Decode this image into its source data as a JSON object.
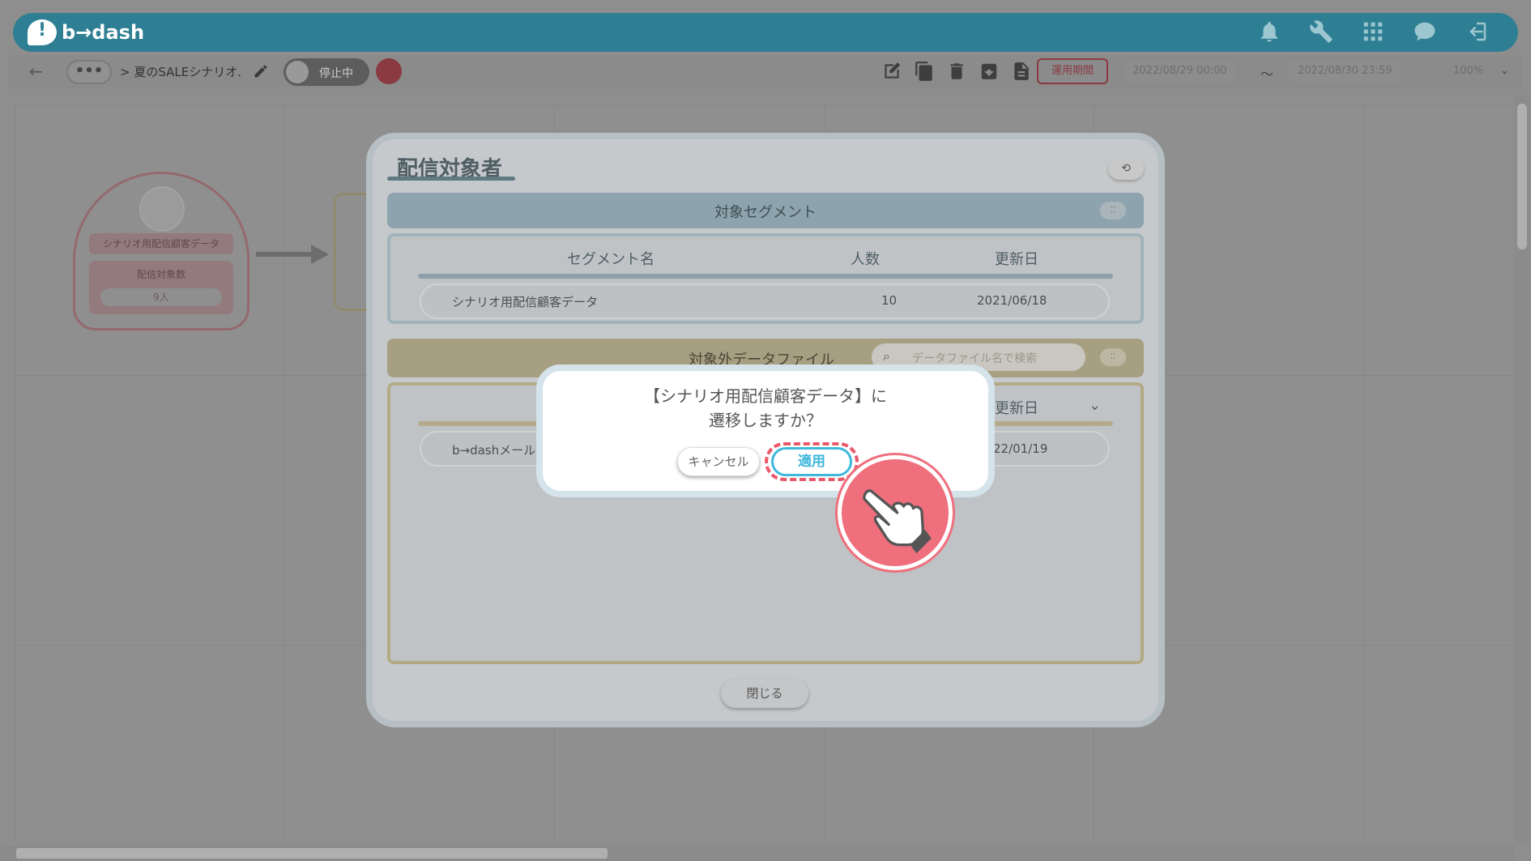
{
  "app": {
    "logo_text": "b→dash"
  },
  "breadcrumb": {
    "more": "•••",
    "path": "> 夏のSALEシナリオ."
  },
  "status_toggle": {
    "label": "停止中"
  },
  "toolbar": {
    "period_label": "運用期間",
    "start_date": "2022/08/29 00:00",
    "separator": "〜",
    "end_date": "2022/08/30 23:59",
    "zoom": "100%"
  },
  "canvas_node": {
    "name": "シナリオ用配信顧客データ",
    "count_label": "配信対象数",
    "count_value": "9人"
  },
  "modal": {
    "title": "配信対象者",
    "segment_section": {
      "header": "対象セグメント",
      "columns": [
        "セグメント名",
        "人数",
        "更新日"
      ],
      "rows": [
        {
          "name": "シナリオ用配信顧客データ",
          "count": "10",
          "updated": "2021/06/18"
        }
      ]
    },
    "exclusion_section": {
      "header": "対象外データファイル",
      "search_placeholder": "データファイル名で検索",
      "columns": [
        "更新日"
      ],
      "rows": [
        {
          "name": "b→dashメール",
          "updated": "22/01/19"
        }
      ]
    },
    "close_label": "閉じる"
  },
  "dialog": {
    "line1": "【シナリオ用配信顧客データ】に",
    "line2": "遷移しますか？",
    "cancel_label": "キャンセル",
    "apply_label": "適用"
  },
  "colors": {
    "brand": "#5fc6e0",
    "apply_button": "#3fb8dc",
    "highlight": "#e9596c"
  }
}
